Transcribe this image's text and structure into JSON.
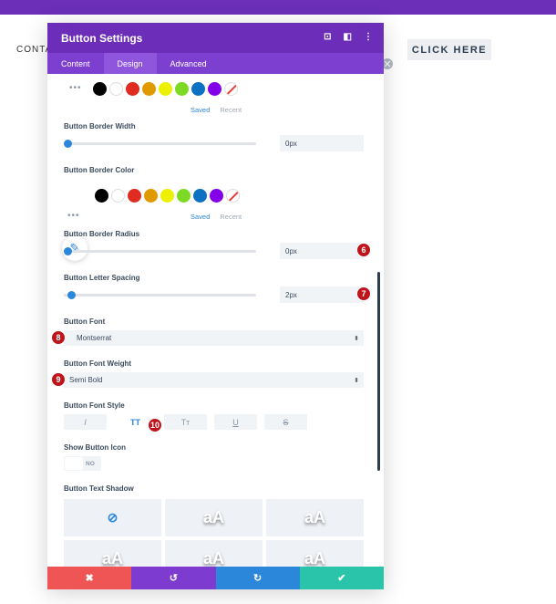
{
  "page": {
    "bg_text": "CONTA",
    "cta_label": "CLICK HERE",
    "close_glyph": "✕"
  },
  "modal": {
    "title": "Button Settings",
    "header_icons": [
      "⊡",
      "◧",
      "⋮"
    ],
    "tabs": [
      {
        "label": "Content"
      },
      {
        "label": "Design"
      },
      {
        "label": "Advanced"
      }
    ]
  },
  "palette": {
    "colors": [
      "#000000",
      "#ffffff",
      "#e02b20",
      "#e09900",
      "#edf000",
      "#7cda24",
      "#0c71c3",
      "#8300e9"
    ],
    "dots": "•••",
    "saved": "Saved",
    "recent": "Recent"
  },
  "border_width": {
    "label": "Button Border Width",
    "value": "0px",
    "slider": 0.0
  },
  "border_color": {
    "label": "Button Border Color",
    "eyedropper_icon": "eyedropper-icon",
    "eyedropper_glyph": "✎"
  },
  "border_radius": {
    "label": "Button Border Radius",
    "value": "0px",
    "slider": 0.0,
    "badge": "6"
  },
  "letter_spacing": {
    "label": "Button Letter Spacing",
    "value": "2px",
    "slider": 0.02,
    "badge": "7"
  },
  "font": {
    "label": "Button Font",
    "value": "Montserrat",
    "badge": "8",
    "caret": "⬍"
  },
  "font_weight": {
    "label": "Button Font Weight",
    "value": "Semi Bold",
    "badge": "9",
    "caret": "⬍"
  },
  "font_style": {
    "label": "Button Font Style",
    "badge": "10",
    "buttons": [
      "I",
      "TT",
      "Tт",
      "U",
      "S"
    ]
  },
  "show_icon": {
    "label": "Show Button Icon",
    "value": "NO"
  },
  "text_shadow": {
    "label": "Button Text Shadow",
    "none_glyph": "⊘",
    "preview": "aA"
  },
  "footer": {
    "cancel": "✖",
    "undo": "↺",
    "redo": "↻",
    "save": "✔",
    "colors": [
      "#ef5555",
      "#7e3bd0",
      "#2b87da",
      "#29c4a9"
    ]
  }
}
